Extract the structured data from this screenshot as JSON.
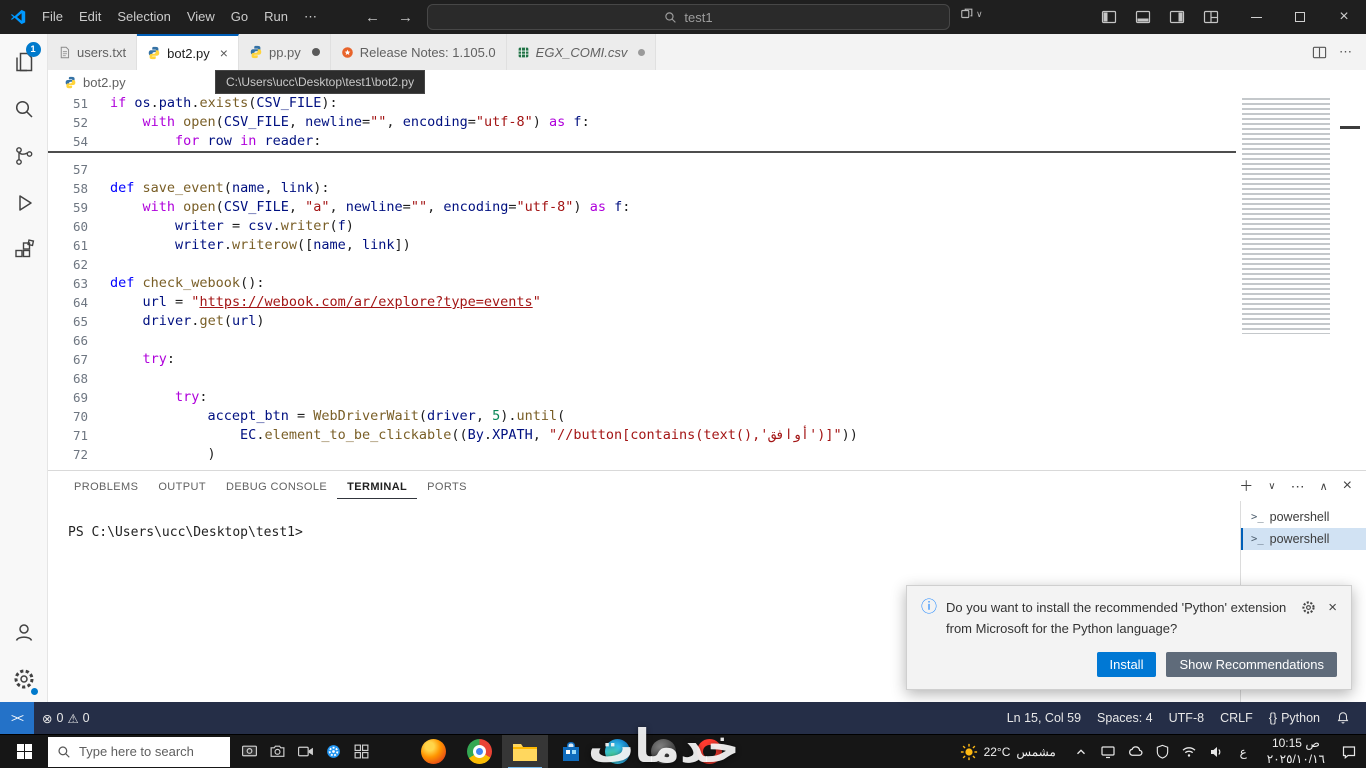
{
  "window": {
    "menu": [
      "File",
      "Edit",
      "Selection",
      "View",
      "Go",
      "Run",
      "⋯"
    ],
    "search_text": "test1"
  },
  "tabs": {
    "items": [
      {
        "label": "users.txt"
      },
      {
        "label": "bot2.py"
      },
      {
        "label": "pp.py"
      },
      {
        "label": "Release Notes: 1.105.0"
      },
      {
        "label": "EGX_COMI.csv"
      }
    ]
  },
  "breadcrumb": {
    "file": "bot2.py",
    "tooltip": "C:\\Users\\ucc\\Desktop\\test1\\bot2.py"
  },
  "editor": {
    "sticky": [
      {
        "n": "51",
        "t": [
          [
            "k",
            "if "
          ],
          [
            "v",
            "os"
          ],
          [
            "p",
            "."
          ],
          [
            "v",
            "path"
          ],
          [
            "p",
            "."
          ],
          [
            "f",
            "exists"
          ],
          [
            "p",
            "("
          ],
          [
            "v",
            "CSV_FILE"
          ],
          [
            "p",
            "):"
          ]
        ]
      },
      {
        "n": "52",
        "t": [
          [
            "p",
            "    "
          ],
          [
            "k",
            "with "
          ],
          [
            "f",
            "open"
          ],
          [
            "p",
            "("
          ],
          [
            "v",
            "CSV_FILE"
          ],
          [
            "p",
            ", "
          ],
          [
            "v",
            "newline"
          ],
          [
            "p",
            "="
          ],
          [
            "s",
            "\"\""
          ],
          [
            "p",
            ", "
          ],
          [
            "v",
            "encoding"
          ],
          [
            "p",
            "="
          ],
          [
            "s",
            "\"utf-8\""
          ],
          [
            "p",
            ") "
          ],
          [
            "k",
            "as "
          ],
          [
            "v",
            "f"
          ],
          [
            "p",
            ":"
          ]
        ]
      },
      {
        "n": "54",
        "t": [
          [
            "p",
            "        "
          ],
          [
            "k",
            "for "
          ],
          [
            "v",
            "row"
          ],
          [
            "p",
            " "
          ],
          [
            "k",
            "in "
          ],
          [
            "v",
            "reader"
          ],
          [
            "p",
            ":"
          ]
        ]
      }
    ],
    "lines": [
      {
        "n": "57",
        "t": []
      },
      {
        "n": "58",
        "t": [
          [
            "b",
            "def "
          ],
          [
            "f",
            "save_event"
          ],
          [
            "p",
            "("
          ],
          [
            "v",
            "name"
          ],
          [
            "p",
            ", "
          ],
          [
            "v",
            "link"
          ],
          [
            "p",
            "):"
          ]
        ]
      },
      {
        "n": "59",
        "t": [
          [
            "p",
            "    "
          ],
          [
            "k",
            "with "
          ],
          [
            "f",
            "open"
          ],
          [
            "p",
            "("
          ],
          [
            "v",
            "CSV_FILE"
          ],
          [
            "p",
            ", "
          ],
          [
            "s",
            "\"a\""
          ],
          [
            "p",
            ", "
          ],
          [
            "v",
            "newline"
          ],
          [
            "p",
            "="
          ],
          [
            "s",
            "\"\""
          ],
          [
            "p",
            ", "
          ],
          [
            "v",
            "encoding"
          ],
          [
            "p",
            "="
          ],
          [
            "s",
            "\"utf-8\""
          ],
          [
            "p",
            ") "
          ],
          [
            "k",
            "as "
          ],
          [
            "v",
            "f"
          ],
          [
            "p",
            ":"
          ]
        ]
      },
      {
        "n": "60",
        "t": [
          [
            "p",
            "        "
          ],
          [
            "v",
            "writer"
          ],
          [
            "p",
            " = "
          ],
          [
            "v",
            "csv"
          ],
          [
            "p",
            "."
          ],
          [
            "f",
            "writer"
          ],
          [
            "p",
            "("
          ],
          [
            "v",
            "f"
          ],
          [
            "p",
            ")"
          ]
        ]
      },
      {
        "n": "61",
        "t": [
          [
            "p",
            "        "
          ],
          [
            "v",
            "writer"
          ],
          [
            "p",
            "."
          ],
          [
            "f",
            "writerow"
          ],
          [
            "p",
            "(["
          ],
          [
            "v",
            "name"
          ],
          [
            "p",
            ", "
          ],
          [
            "v",
            "link"
          ],
          [
            "p",
            "])"
          ]
        ]
      },
      {
        "n": "62",
        "t": []
      },
      {
        "n": "63",
        "t": [
          [
            "b",
            "def "
          ],
          [
            "f",
            "check_webook"
          ],
          [
            "p",
            "():"
          ]
        ]
      },
      {
        "n": "64",
        "t": [
          [
            "p",
            "    "
          ],
          [
            "v",
            "url"
          ],
          [
            "p",
            " = "
          ],
          [
            "s",
            "\""
          ],
          [
            "u",
            "https://webook.com/ar/explore?type=events"
          ],
          [
            "s",
            "\""
          ]
        ]
      },
      {
        "n": "65",
        "t": [
          [
            "p",
            "    "
          ],
          [
            "v",
            "driver"
          ],
          [
            "p",
            "."
          ],
          [
            "f",
            "get"
          ],
          [
            "p",
            "("
          ],
          [
            "v",
            "url"
          ],
          [
            "p",
            ")"
          ]
        ]
      },
      {
        "n": "66",
        "t": []
      },
      {
        "n": "67",
        "t": [
          [
            "p",
            "    "
          ],
          [
            "k",
            "try"
          ],
          [
            "p",
            ":"
          ]
        ]
      },
      {
        "n": "68",
        "t": []
      },
      {
        "n": "69",
        "t": [
          [
            "p",
            "        "
          ],
          [
            "k",
            "try"
          ],
          [
            "p",
            ":"
          ]
        ]
      },
      {
        "n": "70",
        "t": [
          [
            "p",
            "            "
          ],
          [
            "v",
            "accept_btn"
          ],
          [
            "p",
            " = "
          ],
          [
            "f",
            "WebDriverWait"
          ],
          [
            "p",
            "("
          ],
          [
            "v",
            "driver"
          ],
          [
            "p",
            ", "
          ],
          [
            "n",
            "5"
          ],
          [
            "p",
            ")."
          ],
          [
            "f",
            "until"
          ],
          [
            "p",
            "("
          ]
        ]
      },
      {
        "n": "71",
        "t": [
          [
            "p",
            "                "
          ],
          [
            "v",
            "EC"
          ],
          [
            "p",
            "."
          ],
          [
            "f",
            "element_to_be_clickable"
          ],
          [
            "p",
            "(("
          ],
          [
            "v",
            "By"
          ],
          [
            "p",
            "."
          ],
          [
            "v",
            "XPATH"
          ],
          [
            "p",
            ", "
          ],
          [
            "s",
            "\"//button[contains(text(),'أوافق')]\""
          ],
          [
            "p",
            "))"
          ]
        ]
      },
      {
        "n": "72",
        "t": [
          [
            "p",
            "            )"
          ]
        ]
      }
    ]
  },
  "panel": {
    "tabs": [
      "PROBLEMS",
      "OUTPUT",
      "DEBUG CONSOLE",
      "TERMINAL",
      "PORTS"
    ],
    "prompt": "PS C:\\Users\\ucc\\Desktop\\test1>",
    "shells": [
      "powershell",
      "powershell"
    ]
  },
  "notification": {
    "message": "Do you want to install the recommended 'Python' extension from Microsoft for the Python language?",
    "install_label": "Install",
    "show_rec_label": "Show Recommendations"
  },
  "status_bar": {
    "errors": "0",
    "warnings": "0",
    "ln_col": "Ln 15, Col 59",
    "spaces": "Spaces: 4",
    "encoding": "UTF-8",
    "eol": "CRLF",
    "braces": "{}",
    "language": "Python",
    "explorer_badge": "1"
  },
  "taskbar": {
    "search_placeholder": "Type here to search",
    "weather_temp": "22°C",
    "weather_desc": "مشمس",
    "lang_indicator": "ع",
    "time": "10:15 ص",
    "date": "٢٠٢٥/١٠/١٦",
    "watermark": "خدمات"
  },
  "colors": {
    "accent": "#0078d4",
    "status_bar": "#252e47"
  }
}
